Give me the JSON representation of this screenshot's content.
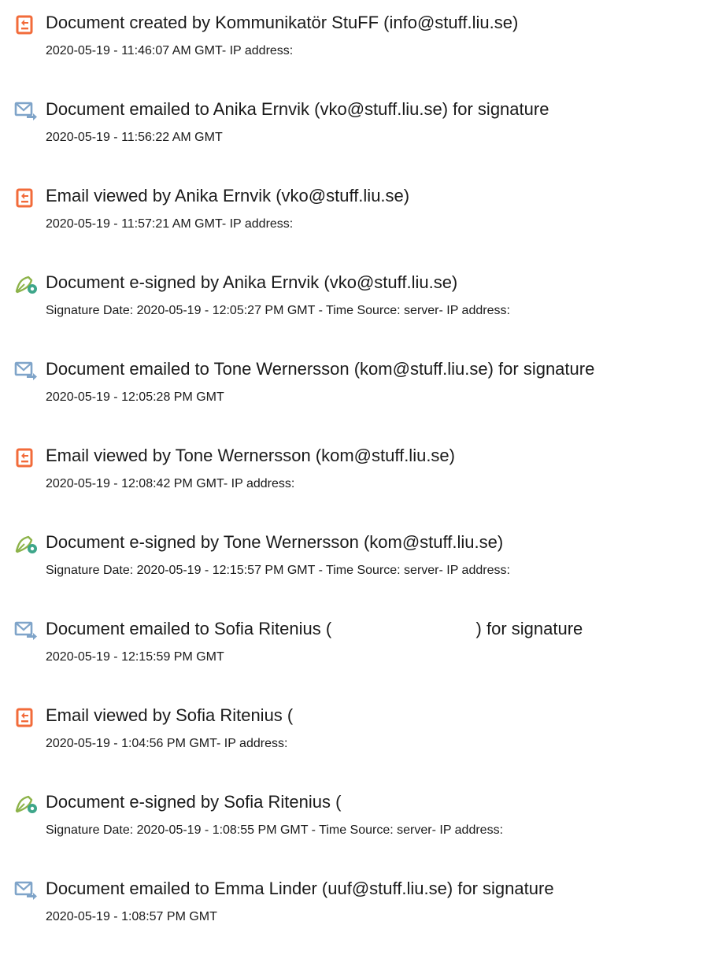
{
  "colors": {
    "created_viewed_icon": "#f26b3a",
    "email_icon": "#7fa4c9",
    "signed_icon_pen": "#8db34a",
    "signed_icon_badge": "#3ea68a",
    "text": "#1a1a1a"
  },
  "events": [
    {
      "icon": "document-icon",
      "title": "Document created by Kommunikatör StuFF (info@stuff.liu.se)",
      "detail": "2020-05-19 - 11:46:07 AM GMT- IP address:"
    },
    {
      "icon": "email-sent-icon",
      "title": "Document emailed to Anika Ernvik (vko@stuff.liu.se) for signature",
      "detail": "2020-05-19 - 11:56:22 AM GMT"
    },
    {
      "icon": "document-icon",
      "title": "Email viewed by Anika Ernvik (vko@stuff.liu.se)",
      "detail": "2020-05-19 - 11:57:21 AM GMT- IP address:"
    },
    {
      "icon": "esign-pen-icon",
      "title": "Document e-signed by Anika Ernvik (vko@stuff.liu.se)",
      "detail": "Signature Date: 2020-05-19 - 12:05:27 PM GMT - Time Source: server- IP address:"
    },
    {
      "icon": "email-sent-icon",
      "title": "Document emailed to Tone Wernersson (kom@stuff.liu.se) for signature",
      "detail": "2020-05-19 - 12:05:28 PM GMT"
    },
    {
      "icon": "document-icon",
      "title": "Email viewed by Tone Wernersson (kom@stuff.liu.se)",
      "detail": "2020-05-19 - 12:08:42 PM GMT- IP address:"
    },
    {
      "icon": "esign-pen-icon",
      "title": "Document e-signed by Tone Wernersson (kom@stuff.liu.se)",
      "detail": "Signature Date: 2020-05-19 - 12:15:57 PM GMT - Time Source: server- IP address:"
    },
    {
      "icon": "email-sent-icon",
      "title": "Document emailed to Sofia Ritenius (                              ) for signature",
      "detail": "2020-05-19 - 12:15:59 PM GMT"
    },
    {
      "icon": "document-icon",
      "title": "Email viewed by Sofia Ritenius (",
      "detail": "2020-05-19 - 1:04:56 PM GMT- IP address:"
    },
    {
      "icon": "esign-pen-icon",
      "title": "Document e-signed by Sofia Ritenius (",
      "detail": "Signature Date: 2020-05-19 - 1:08:55 PM GMT - Time Source: server- IP address:"
    },
    {
      "icon": "email-sent-icon",
      "title": "Document emailed to Emma Linder (uuf@stuff.liu.se) for signature",
      "detail": "2020-05-19 - 1:08:57 PM GMT"
    }
  ]
}
